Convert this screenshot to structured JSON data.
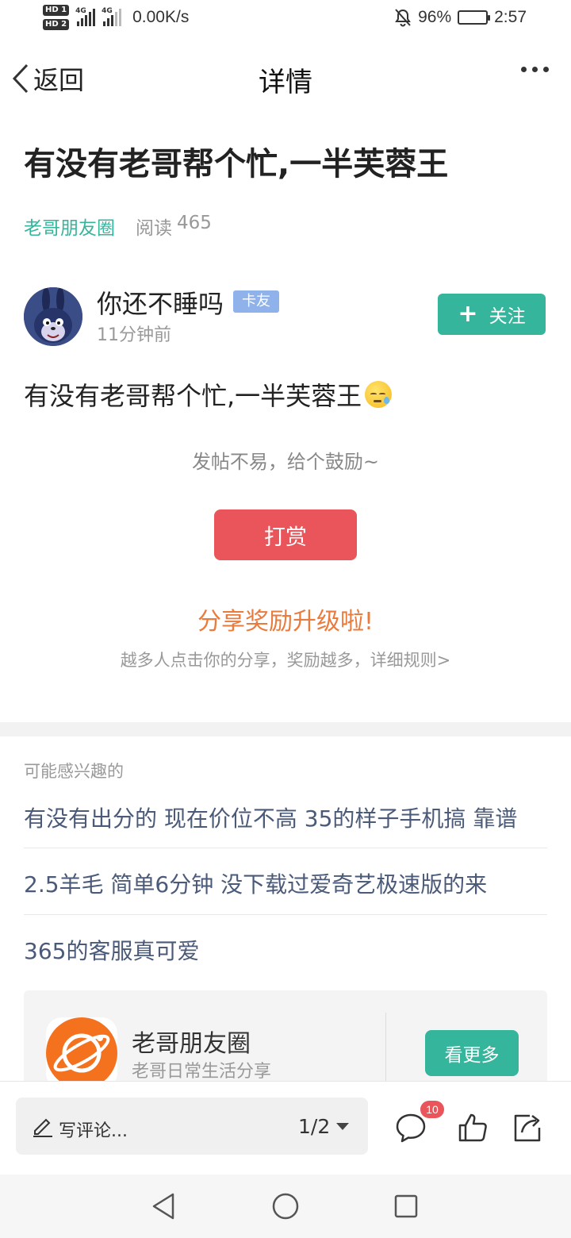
{
  "status_bar": {
    "hd1": "HD 1",
    "hd2": "HD 2",
    "net1": "4G",
    "net2": "4G",
    "speed": "0.00K/s",
    "battery": "96%",
    "battery_level": 0.96,
    "time": "2:57"
  },
  "nav": {
    "back_label": "返回",
    "title": "详情"
  },
  "post": {
    "title": "有没有老哥帮个忙,一半芙蓉王",
    "circle": "老哥朋友圈",
    "reads_label": "阅读",
    "reads_count": "465"
  },
  "author": {
    "name": "你还不睡吗",
    "badge": "卡友",
    "time": "11分钟前",
    "follow_label": "关注"
  },
  "content": {
    "text": "有没有老哥帮个忙,一半芙蓉王"
  },
  "reward": {
    "encourage": "发帖不易，给个鼓励~",
    "button": "打赏",
    "share_title": "分享奖励升级啦!",
    "share_desc": "越多人点击你的分享，奖励越多，详细规则>"
  },
  "recommend": {
    "header": "可能感兴趣的",
    "items": [
      "有没有出分的 现在价位不高 35的样子手机搞 靠谱",
      "2.5羊毛 简单6分钟 没下载过爱奇艺极速版的来",
      "365的客服真可爱"
    ]
  },
  "circle_card": {
    "title": "老哥朋友圈",
    "subtitle": "老哥日常生活分享",
    "button": "看更多"
  },
  "bottom_bar": {
    "comment_placeholder": "写评论...",
    "page_indicator": "1/2",
    "comment_count": "10"
  },
  "colors": {
    "accent_green": "#35b59c",
    "reward_red": "#e9555a",
    "share_orange": "#ea7b3c",
    "link_blue": "#4a5a78",
    "badge_blue": "#8fb2ea"
  },
  "icons": {
    "back": "chevron-left-icon",
    "more": "more-dots-icon",
    "plus": "plus-icon",
    "edit": "pencil-icon",
    "comment": "comment-bubble-icon",
    "like": "thumbs-up-icon",
    "share": "share-icon",
    "mute": "bell-off-icon",
    "nav_back": "triangle-back-icon",
    "nav_home": "circle-home-icon",
    "nav_recent": "square-recent-icon"
  }
}
